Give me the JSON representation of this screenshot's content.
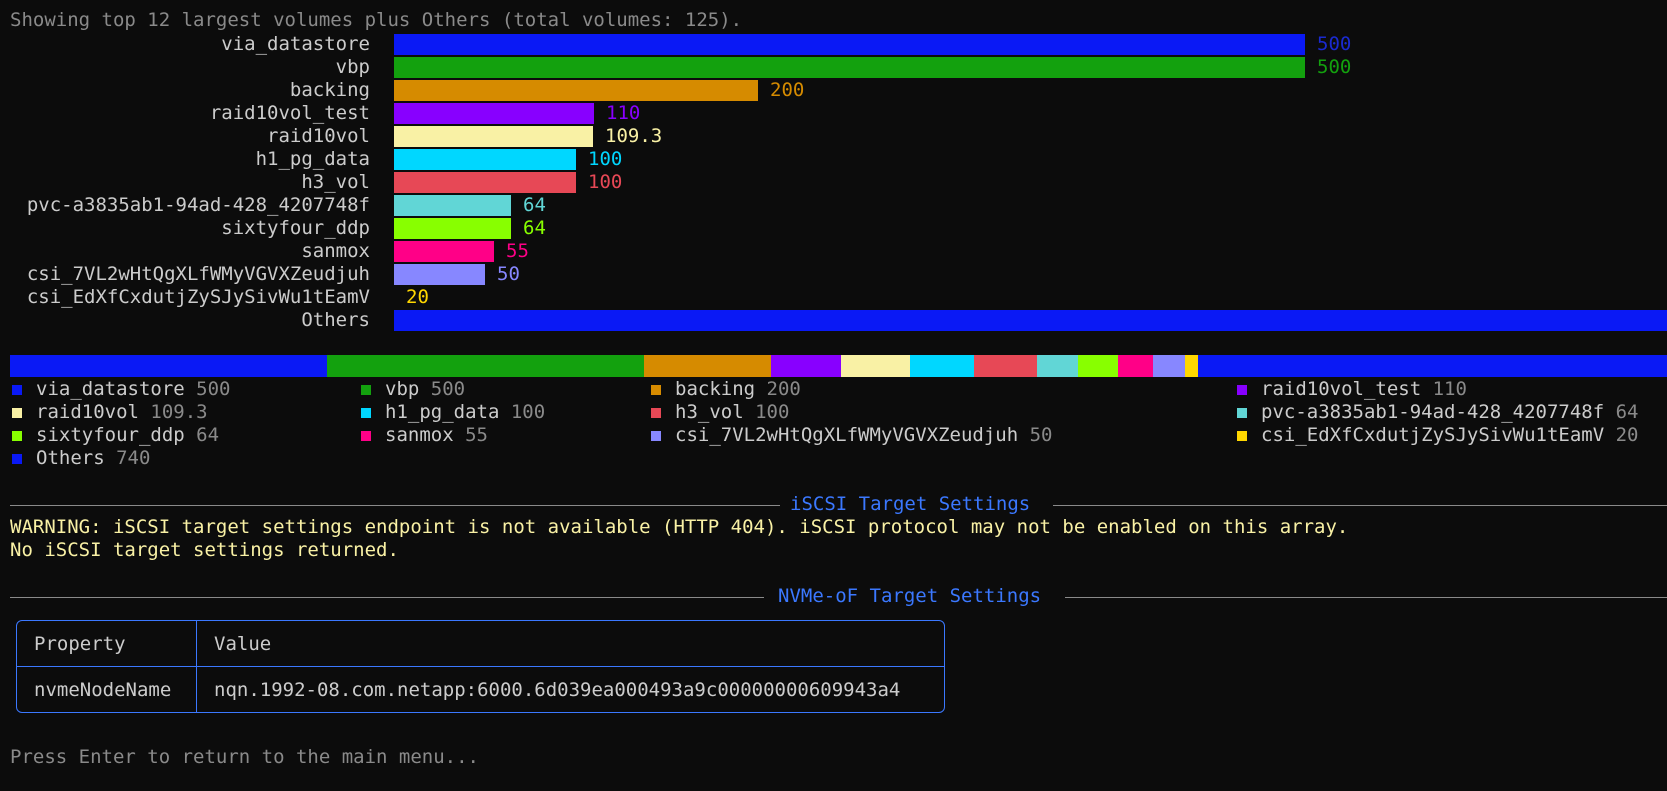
{
  "header_text": "Showing top 12 largest volumes plus Others (total volumes: 125).",
  "chart_data": {
    "type": "bar",
    "orientation": "horizontal",
    "categories": [
      "via_datastore",
      "vbp",
      "backing",
      "raid10vol_test",
      "raid10vol",
      "h1_pg_data",
      "h3_vol",
      "pvc-a3835ab1-94ad-428_4207748f",
      "sixtyfour_ddp",
      "sanmox",
      "csi_7VL2wHtQgXLfWMyVGVXZeudjuh",
      "csi_EdXfCxdutjZySJySivWu1tEamV",
      "Others"
    ],
    "values": [
      500,
      500,
      200,
      110,
      109.3,
      100,
      100,
      64,
      64,
      55,
      50,
      20,
      740
    ],
    "value_labels": [
      "500",
      "500",
      "200",
      "110",
      "109.3",
      "100",
      "100",
      "64",
      "64",
      "55",
      "50",
      "20",
      ""
    ],
    "colors": [
      "#0a19f5",
      "#13a10e",
      "#d68b00",
      "#8800ff",
      "#f9f1a5",
      "#00d7ff",
      "#e74856",
      "#61d6d6",
      "#88ff00",
      "#ff0087",
      "#8787ff",
      "#ffd700",
      "#0a19f5"
    ]
  },
  "legend": [
    {
      "name": "via_datastore",
      "count": "500"
    },
    {
      "name": "vbp",
      "count": "500"
    },
    {
      "name": "backing",
      "count": "200"
    },
    {
      "name": "raid10vol_test",
      "count": "110"
    },
    {
      "name": "raid10vol",
      "count": "109.3"
    },
    {
      "name": "h1_pg_data",
      "count": "100"
    },
    {
      "name": "h3_vol",
      "count": "100"
    },
    {
      "name": "pvc-a3835ab1-94ad-428_4207748f",
      "count": "64"
    },
    {
      "name": "sixtyfour_ddp",
      "count": "64"
    },
    {
      "name": "sanmox",
      "count": "55"
    },
    {
      "name": "csi_7VL2wHtQgXLfWMyVGVXZeudjuh",
      "count": "50"
    },
    {
      "name": "csi_EdXfCxdutjZySJySivWu1tEamV",
      "count": "20"
    },
    {
      "name": "Others",
      "count": "740"
    }
  ],
  "iscsi": {
    "title": "iSCSI Target Settings",
    "warning": "WARNING: iSCSI target settings endpoint is not available (HTTP 404). iSCSI protocol may not be enabled on this array.",
    "note": "No iSCSI target settings returned."
  },
  "nvme": {
    "title": "NVMe-oF Target Settings",
    "headers": {
      "property": "Property",
      "value": "Value"
    },
    "rows": [
      {
        "property": "nvmeNodeName",
        "value": "nqn.1992-08.com.netapp:6000.6d039ea000493a9c00000000609943a4"
      }
    ]
  },
  "footer_prompt": "Press Enter to return to the main menu..."
}
